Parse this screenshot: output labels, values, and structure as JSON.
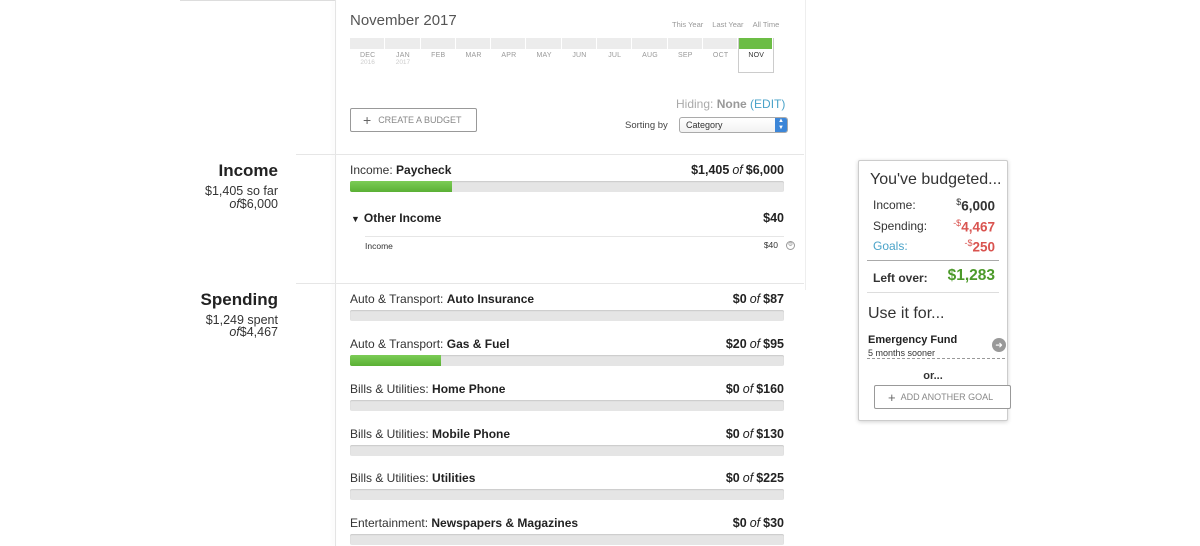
{
  "header": {
    "period": "November 2017",
    "ranges": [
      "This Year",
      "Last Year",
      "All Time"
    ],
    "months": [
      {
        "label": "DEC",
        "year": "2016"
      },
      {
        "label": "JAN",
        "year": "2017"
      },
      {
        "label": "FEB",
        "year": ""
      },
      {
        "label": "MAR",
        "year": ""
      },
      {
        "label": "APR",
        "year": ""
      },
      {
        "label": "MAY",
        "year": ""
      },
      {
        "label": "JUN",
        "year": ""
      },
      {
        "label": "JUL",
        "year": ""
      },
      {
        "label": "AUG",
        "year": ""
      },
      {
        "label": "SEP",
        "year": ""
      },
      {
        "label": "OCT",
        "year": ""
      },
      {
        "label": "NOV",
        "year": ""
      }
    ],
    "active_month": "NOV",
    "hiding_label": "Hiding:",
    "hiding_value": "None",
    "edit_label": "(EDIT)",
    "create_budget_label": "CREATE A BUDGET",
    "sorting_label": "Sorting by",
    "sorting_value": "Category"
  },
  "income_summary": {
    "title": "Income",
    "so_far": "$1,405 so far",
    "of_word": "of",
    "of_value": "$6,000"
  },
  "spending_summary": {
    "title": "Spending",
    "spent": "$1,249 spent",
    "of_word": "of",
    "of_value": "$4,467"
  },
  "income_rows": [
    {
      "category": "Income:",
      "name": "Paycheck",
      "spent": "$1,405",
      "of": "of",
      "budget": "$6,000",
      "progress": 0.235
    }
  ],
  "other_income": {
    "title": "Other Income",
    "amount": "$40",
    "sub_label": "Income",
    "sub_amount": "$40"
  },
  "spending_rows": [
    {
      "category": "Auto & Transport:",
      "name": "Auto Insurance",
      "spent": "$0",
      "of": "of",
      "budget": "$87",
      "progress": 0
    },
    {
      "category": "Auto & Transport:",
      "name": "Gas & Fuel",
      "spent": "$20",
      "of": "of",
      "budget": "$95",
      "progress": 0.21
    },
    {
      "category": "Bills & Utilities:",
      "name": "Home Phone",
      "spent": "$0",
      "of": "of",
      "budget": "$160",
      "progress": 0
    },
    {
      "category": "Bills & Utilities:",
      "name": "Mobile Phone",
      "spent": "$0",
      "of": "of",
      "budget": "$130",
      "progress": 0
    },
    {
      "category": "Bills & Utilities:",
      "name": "Utilities",
      "spent": "$0",
      "of": "of",
      "budget": "$225",
      "progress": 0
    },
    {
      "category": "Entertainment:",
      "name": "Newspapers & Magazines",
      "spent": "$0",
      "of": "of",
      "budget": "$30",
      "progress": 0
    }
  ],
  "panel": {
    "title": "You've budgeted...",
    "income_label": "Income:",
    "income_sign": "$",
    "income_value": "6,000",
    "spending_label": "Spending:",
    "spending_sign": "-$",
    "spending_value": "4,467",
    "goals_label": "Goals:",
    "goals_sign": "-$",
    "goals_value": "250",
    "leftover_label": "Left over:",
    "leftover_value": "$1,283",
    "use_for_label": "Use it for...",
    "goal_name": "Emergency Fund",
    "goal_sub": "5 months sooner",
    "or_label": "or...",
    "add_goal_label": "ADD ANOTHER GOAL"
  },
  "colors": {
    "progress_green": "#5ab034",
    "negative_red": "#d9534f",
    "leftover_green": "#4c9a2a",
    "link_blue": "#4aa3c9",
    "select_blue": "#3c86d8"
  }
}
